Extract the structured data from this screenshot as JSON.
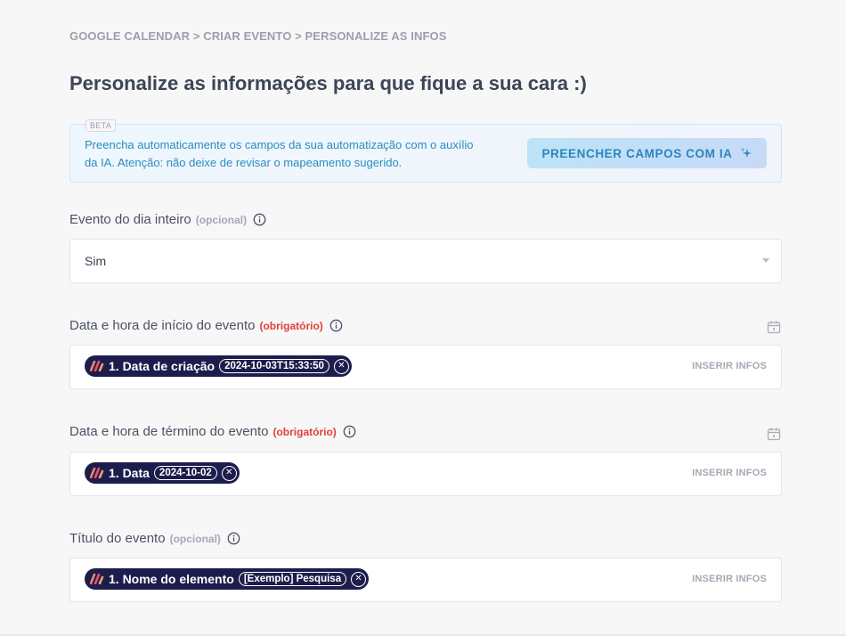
{
  "breadcrumb": "GOOGLE CALENDAR > CRIAR EVENTO > PERSONALIZE AS INFOS",
  "page_title": "Personalize as informações para que fique a sua cara :)",
  "ai_box": {
    "badge": "BETA",
    "text": "Preencha automaticamente os campos da sua automatização com o auxílio da IA. Atenção: não deixe de revisar o mapeamento sugerido.",
    "button_label": "PREENCHER CAMPOS COM IA",
    "button_icon": "sparkle-icon"
  },
  "fields": [
    {
      "label": "Evento do dia inteiro",
      "tag": "(opcional)",
      "tag_type": "optional",
      "type": "select",
      "value": "Sim"
    },
    {
      "label": "Data e hora de início do evento",
      "tag": "(obrigatório)",
      "tag_type": "required",
      "type": "chips",
      "calendar_icon": "calendar-icon",
      "chip": {
        "label": "1. Data de criação",
        "value": "2024-10-03T15:33:50"
      },
      "insert_label": "INSERIR INFOS"
    },
    {
      "label": "Data e hora de término do evento",
      "tag": "(obrigatório)",
      "tag_type": "required",
      "type": "chips",
      "calendar_icon": "calendar-icon",
      "chip": {
        "label": "1. Data",
        "value": "2024-10-02"
      },
      "insert_label": "INSERIR INFOS"
    },
    {
      "label": "Título do evento",
      "tag": "(opcional)",
      "tag_type": "optional",
      "type": "chips",
      "chip": {
        "label": "1. Nome do elemento",
        "value": "[Exemplo] Pesquisa"
      },
      "insert_label": "INSERIR INFOS"
    }
  ],
  "colors": {
    "background": "#f7f7f8",
    "accent_blue": "#2a86bd",
    "required_red": "#e0413a",
    "chip_navy": "#1d1d4d"
  }
}
